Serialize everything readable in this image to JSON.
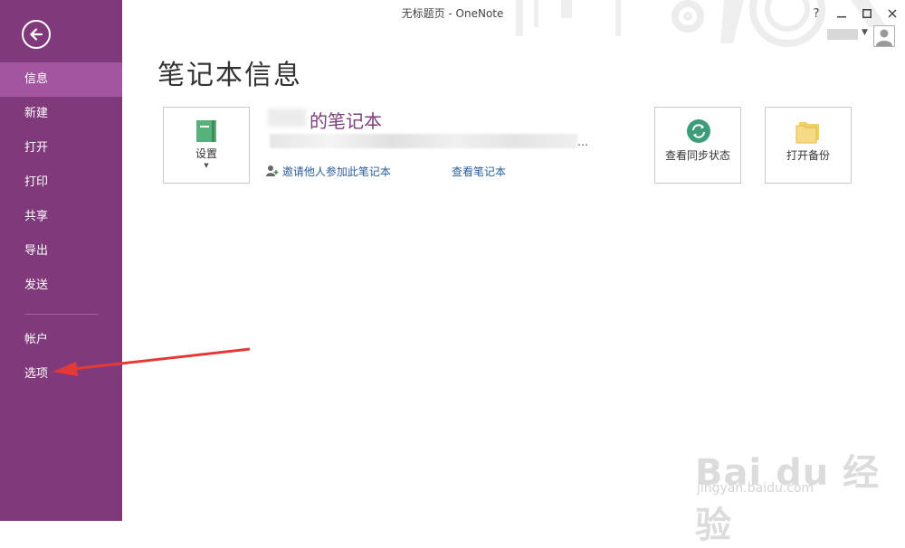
{
  "window": {
    "title": "无标题页 - OneNote"
  },
  "sidebar": {
    "items": [
      {
        "label": "信息"
      },
      {
        "label": "新建"
      },
      {
        "label": "打开"
      },
      {
        "label": "打印"
      },
      {
        "label": "共享"
      },
      {
        "label": "导出"
      },
      {
        "label": "发送"
      },
      {
        "label": "帐户"
      },
      {
        "label": "选项"
      }
    ],
    "active": "信息"
  },
  "main": {
    "title": "笔记本信息",
    "settings_tile": {
      "label": "设置"
    },
    "notebook_name": "的笔记本",
    "invite_link": "邀请他人参加此笔记本",
    "view_link": "查看笔记本",
    "sync_tile": {
      "label": "查看同步状态"
    },
    "backup_tile": {
      "label": "打开备份"
    }
  },
  "controls": {
    "help": "?"
  },
  "watermark": {
    "logo": "Bai du 经验",
    "url": "jingyan.baidu.com"
  },
  "colors": {
    "sidebar": "#80397b",
    "sidebar_active": "#a356a0",
    "accent_text": "#7a3e7a",
    "link": "#2a5d9b"
  }
}
